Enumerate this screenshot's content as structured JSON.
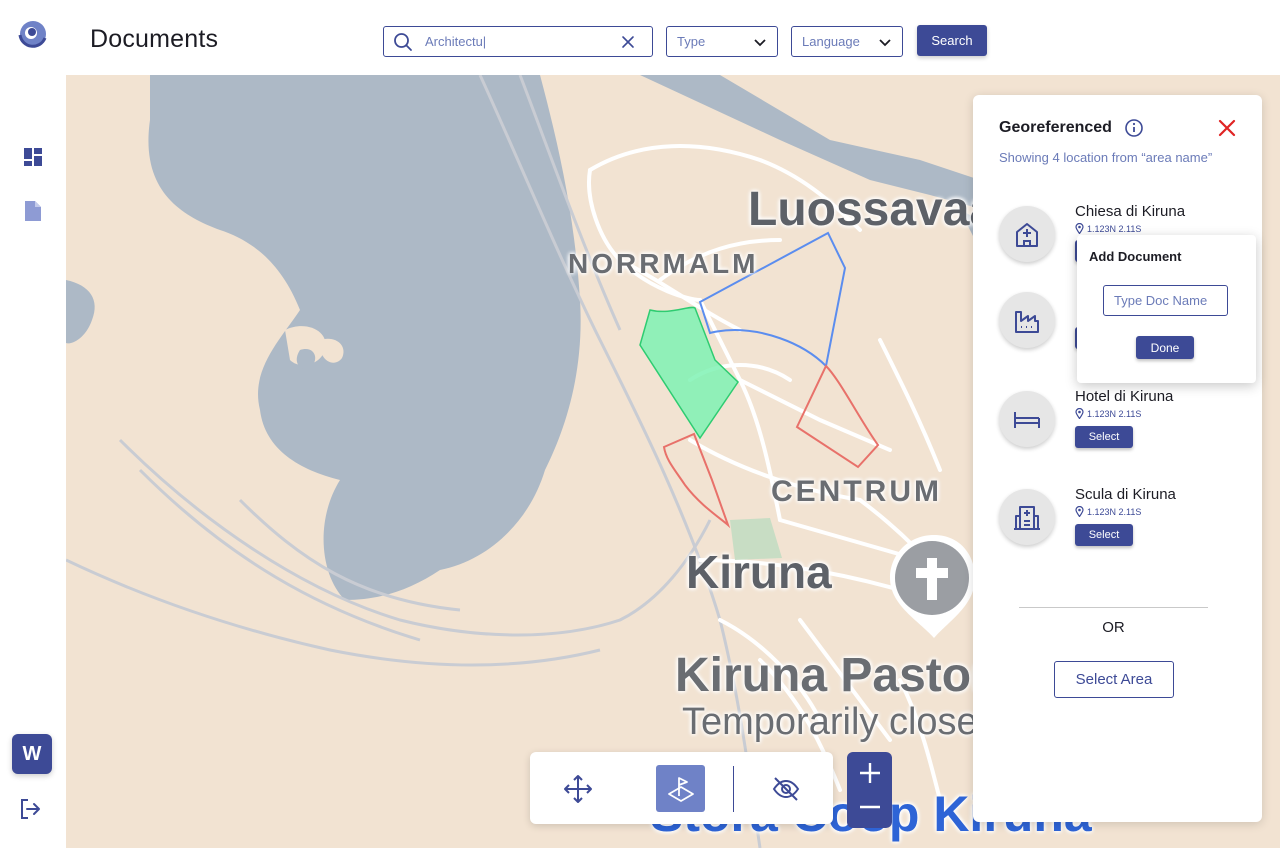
{
  "header": {
    "title": "Documents",
    "search": {
      "value": "Architectu|"
    },
    "type_select": {
      "value": "Type"
    },
    "language_select": {
      "value": "Language"
    },
    "search_button": "Search"
  },
  "sidebar": {
    "items": [
      {
        "icon": "dashboard-icon"
      },
      {
        "icon": "document-icon"
      }
    ],
    "avatar": "W",
    "logout_icon": "logout-icon"
  },
  "map": {
    "labels": {
      "luossavaara": "Luossavaara",
      "norrmalm": "NORRMALM",
      "centrum": "CENTRUM",
      "kiruna": "Kiruna",
      "pastorat": "Kiruna Pastorat",
      "closed": "Temporarily closed",
      "coop": "Stora Coop Kiruna"
    },
    "area_colors": {
      "selected": "#2ecc71",
      "blue": "#5b8def",
      "red": "#e8716a"
    }
  },
  "toolbar": {
    "tools": [
      "move-icon",
      "georeference-icon",
      "hide-icon"
    ],
    "active_tool": "georeference-icon"
  },
  "zoom": {
    "in": "+",
    "out": "−"
  },
  "panel": {
    "title": "Georeferenced",
    "subtitle": "Showing 4 location from “area name”",
    "locations": [
      {
        "name": "Chiesa di Kiruna",
        "coords": "1.123N 2.11S",
        "icon": "church-icon",
        "button": ""
      },
      {
        "name": "",
        "coords": "",
        "icon": "factory-icon",
        "button": ""
      },
      {
        "name": "Hotel di Kiruna",
        "coords": "1.123N 2.11S",
        "icon": "bed-icon",
        "button": "Select"
      },
      {
        "name": "Scula di Kiruna",
        "coords": "1.123N 2.11S",
        "icon": "school-icon",
        "button": "Select"
      }
    ],
    "or_text": "OR",
    "select_area": "Select Area"
  },
  "popover": {
    "title": "Add Document",
    "input_placeholder": "Type Doc Name",
    "done": "Done"
  },
  "colors": {
    "primary": "#3d4a96",
    "muted": "#6b7bb8",
    "close": "#e02424"
  }
}
